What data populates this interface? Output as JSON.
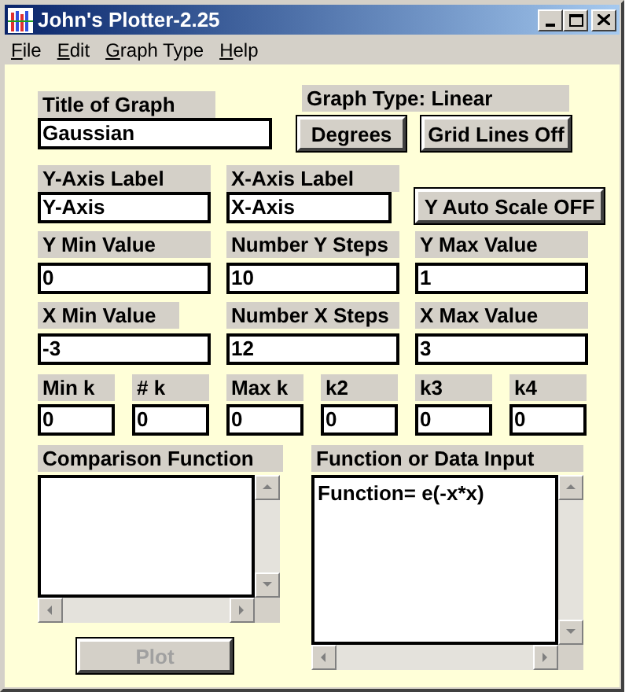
{
  "window": {
    "title": "John's Plotter-2.25"
  },
  "menu": [
    {
      "label": "File"
    },
    {
      "label": "Edit"
    },
    {
      "label": "Graph Type"
    },
    {
      "label": "Help"
    }
  ],
  "title_of_graph": {
    "label": "Title of Graph",
    "value": "Gaussian"
  },
  "graph_type": {
    "label": "Graph Type: Linear"
  },
  "buttons": [
    {
      "label": "Degrees"
    },
    {
      "label": "Grid Lines Off"
    }
  ],
  "axis_labels": [
    {
      "label": "Y-Axis Label",
      "value": "Y-Axis"
    },
    {
      "label": "X-Axis Label",
      "value": "X-Axis"
    }
  ],
  "auto_scale_button": {
    "label": "Y Auto Scale OFF"
  },
  "y_range": [
    {
      "label": "Y Min Value",
      "value": "0"
    },
    {
      "label": "Number Y Steps",
      "value": "10"
    },
    {
      "label": "Y Max Value",
      "value": "1"
    }
  ],
  "x_range": [
    {
      "label": "X Min Value",
      "value": "-3"
    },
    {
      "label": "Number X Steps",
      "value": "12"
    },
    {
      "label": "X Max Value",
      "value": "3"
    }
  ],
  "k_params": [
    {
      "label": "Min k",
      "value": "0"
    },
    {
      "label": "# k",
      "value": "0"
    },
    {
      "label": "Max k",
      "value": "0"
    },
    {
      "label": "k2",
      "value": "0"
    },
    {
      "label": "k3",
      "value": "0"
    },
    {
      "label": "k4",
      "value": "0"
    }
  ],
  "comparison_function": {
    "label": "Comparison Function"
  },
  "plot_button": {
    "label": "Plot",
    "disabled": true
  },
  "function_input": {
    "label": "Function or Data Input",
    "value": "Function= e(-x*x)"
  }
}
